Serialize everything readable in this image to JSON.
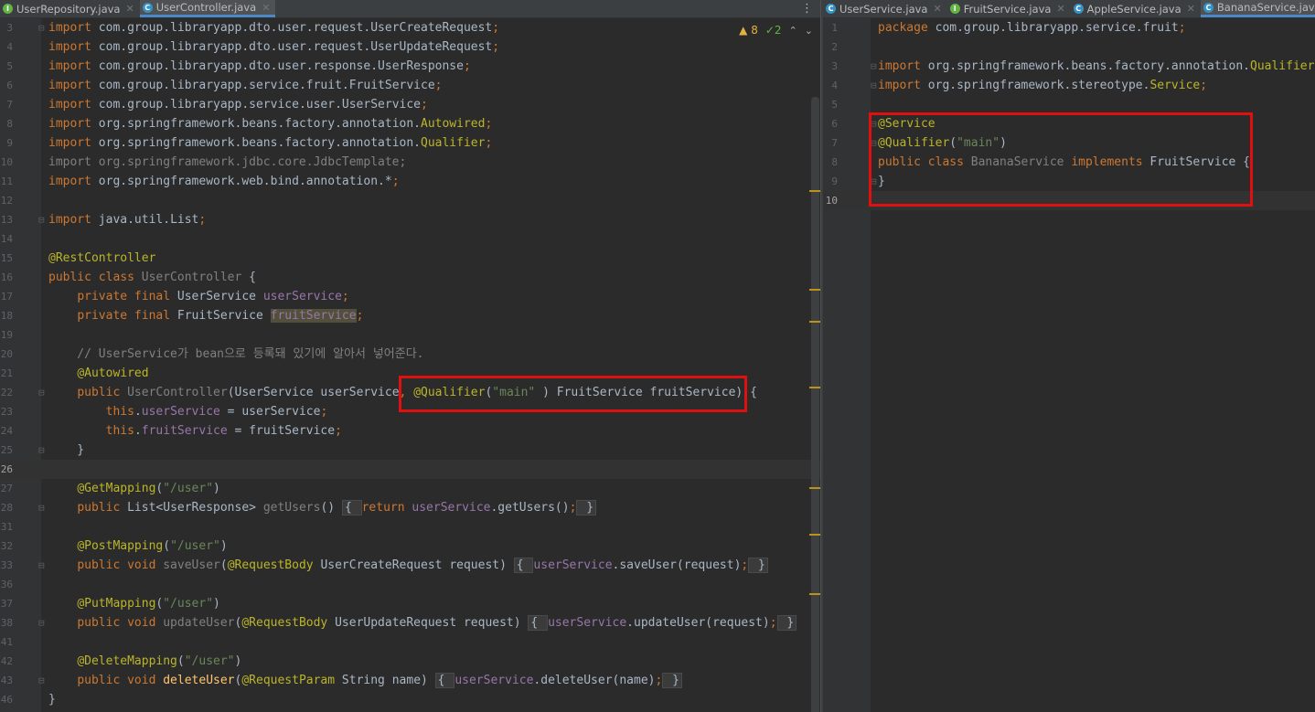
{
  "left_tabs": [
    {
      "label": "UserRepository.java",
      "icon": "interface-file-icon",
      "active": false
    },
    {
      "label": "UserController.java",
      "icon": "class-file-icon",
      "active": true
    }
  ],
  "right_tabs": [
    {
      "label": "UserService.java",
      "icon": "class-file-icon",
      "active": false
    },
    {
      "label": "FruitService.java",
      "icon": "interface-file-icon",
      "active": false
    },
    {
      "label": "AppleService.java",
      "icon": "class-file-icon",
      "active": false
    },
    {
      "label": "BananaService.java",
      "icon": "class-file-icon",
      "active": true
    }
  ],
  "tab_menu_glyph": "⋮",
  "inspections": {
    "warnings": "8",
    "ok": "2",
    "warn_glyph": "▲",
    "ok_glyph": "✓",
    "up_glyph": "⌃",
    "down_glyph": "⌄"
  },
  "left_code": [
    {
      "n": "3",
      "tokens": [
        [
          "k",
          "import "
        ],
        [
          "",
          "com.group.libraryapp.dto.user.request.UserCreateRequest"
        ],
        [
          "k",
          ";"
        ]
      ]
    },
    {
      "n": "4",
      "tokens": [
        [
          "k",
          "import "
        ],
        [
          "",
          "com.group.libraryapp.dto.user.request.UserUpdateRequest"
        ],
        [
          "k",
          ";"
        ]
      ]
    },
    {
      "n": "5",
      "tokens": [
        [
          "k",
          "import "
        ],
        [
          "",
          "com.group.libraryapp.dto.user.response.UserResponse"
        ],
        [
          "k",
          ";"
        ]
      ]
    },
    {
      "n": "6",
      "tokens": [
        [
          "k",
          "import "
        ],
        [
          "",
          "com.group.libraryapp.service.fruit.FruitService"
        ],
        [
          "k",
          ";"
        ]
      ]
    },
    {
      "n": "7",
      "tokens": [
        [
          "k",
          "import "
        ],
        [
          "",
          "com.group.libraryapp.service.user.UserService"
        ],
        [
          "k",
          ";"
        ]
      ]
    },
    {
      "n": "8",
      "tokens": [
        [
          "k",
          "import "
        ],
        [
          "",
          "org.springframework.beans.factory.annotation."
        ],
        [
          "a",
          "Autowired"
        ],
        [
          "k",
          ";"
        ]
      ]
    },
    {
      "n": "9",
      "tokens": [
        [
          "k",
          "import "
        ],
        [
          "",
          "org.springframework.beans.factory.annotation."
        ],
        [
          "a",
          "Qualifier"
        ],
        [
          "k",
          ";"
        ]
      ]
    },
    {
      "n": "10",
      "tokens": [
        [
          "dim",
          "import org.springframework.jdbc.core.JdbcTemplate;"
        ]
      ]
    },
    {
      "n": "11",
      "tokens": [
        [
          "k",
          "import "
        ],
        [
          "",
          "org.springframework.web.bind.annotation.*"
        ],
        [
          "k",
          ";"
        ]
      ]
    },
    {
      "n": "12",
      "tokens": []
    },
    {
      "n": "13",
      "tokens": [
        [
          "k",
          "import "
        ],
        [
          "",
          "java.util.List"
        ],
        [
          "k",
          ";"
        ]
      ]
    },
    {
      "n": "14",
      "tokens": []
    },
    {
      "n": "15",
      "tokens": [
        [
          "a",
          "@RestController"
        ]
      ]
    },
    {
      "n": "16",
      "tokens": [
        [
          "k",
          "public class "
        ],
        [
          "dim",
          "UserController "
        ],
        [
          "",
          "{"
        ]
      ]
    },
    {
      "n": "17",
      "tokens": [
        [
          "",
          "    "
        ],
        [
          "k",
          "private final "
        ],
        [
          "",
          "UserService "
        ],
        [
          "f",
          "userService"
        ],
        [
          "k",
          ";"
        ]
      ]
    },
    {
      "n": "18",
      "tokens": [
        [
          "",
          "    "
        ],
        [
          "k",
          "private final "
        ],
        [
          "",
          "FruitService "
        ],
        [
          "fhl",
          "fruitService"
        ],
        [
          "k",
          ";"
        ]
      ]
    },
    {
      "n": "19",
      "tokens": []
    },
    {
      "n": "20",
      "tokens": [
        [
          "cm",
          "    // UserService가 bean으로 등록돼 있기에 알아서 넣어준다."
        ]
      ]
    },
    {
      "n": "21",
      "tokens": [
        [
          "",
          "    "
        ],
        [
          "a",
          "@Autowired"
        ]
      ]
    },
    {
      "n": "22",
      "tokens": [
        [
          "",
          "    "
        ],
        [
          "k",
          "public "
        ],
        [
          "dim",
          "UserController"
        ],
        [
          "",
          "(UserService userService"
        ],
        [
          "k",
          ", "
        ],
        [
          "a",
          "@Qualifier"
        ],
        [
          "",
          "("
        ],
        [
          "s",
          "\"main\""
        ],
        [
          "",
          " ) FruitService fruitService) {"
        ]
      ]
    },
    {
      "n": "23",
      "tokens": [
        [
          "",
          "        "
        ],
        [
          "k",
          "this"
        ],
        [
          "",
          "."
        ],
        [
          "f",
          "userService"
        ],
        [
          "",
          " = userService"
        ],
        [
          "k",
          ";"
        ]
      ]
    },
    {
      "n": "24",
      "tokens": [
        [
          "",
          "        "
        ],
        [
          "k",
          "this"
        ],
        [
          "",
          "."
        ],
        [
          "f",
          "fruitService"
        ],
        [
          "",
          " = fruitService"
        ],
        [
          "k",
          ";"
        ]
      ]
    },
    {
      "n": "25",
      "tokens": [
        [
          "",
          "    }"
        ]
      ]
    },
    {
      "n": "26",
      "tokens": [],
      "caret": true
    },
    {
      "n": "27",
      "tokens": [
        [
          "",
          "    "
        ],
        [
          "a",
          "@GetMapping"
        ],
        [
          "",
          "("
        ],
        [
          "s",
          "\"/user\""
        ],
        [
          "",
          ")"
        ]
      ]
    },
    {
      "n": "28",
      "tokens": [
        [
          "",
          "    "
        ],
        [
          "k",
          "public "
        ],
        [
          "",
          "List<UserResponse> "
        ],
        [
          "dim",
          "getUsers"
        ],
        [
          "",
          "() "
        ],
        [
          "box",
          "{ "
        ],
        [
          "k",
          "return "
        ],
        [
          "f",
          "userService"
        ],
        [
          "",
          ".getUsers()"
        ],
        [
          "k",
          ";"
        ],
        [
          "box",
          " }"
        ]
      ]
    },
    {
      "n": "31",
      "tokens": []
    },
    {
      "n": "32",
      "tokens": [
        [
          "",
          "    "
        ],
        [
          "a",
          "@PostMapping"
        ],
        [
          "",
          "("
        ],
        [
          "s",
          "\"/user\""
        ],
        [
          "",
          ")"
        ]
      ]
    },
    {
      "n": "33",
      "tokens": [
        [
          "",
          "    "
        ],
        [
          "k",
          "public void "
        ],
        [
          "dim",
          "saveUser"
        ],
        [
          "",
          "("
        ],
        [
          "a",
          "@RequestBody "
        ],
        [
          "",
          "UserCreateRequest request) "
        ],
        [
          "box",
          "{ "
        ],
        [
          "f",
          "userService"
        ],
        [
          "",
          ".saveUser(request)"
        ],
        [
          "k",
          ";"
        ],
        [
          "box",
          " }"
        ]
      ]
    },
    {
      "n": "36",
      "tokens": []
    },
    {
      "n": "37",
      "tokens": [
        [
          "",
          "    "
        ],
        [
          "a",
          "@PutMapping"
        ],
        [
          "",
          "("
        ],
        [
          "s",
          "\"/user\""
        ],
        [
          "",
          ")"
        ]
      ]
    },
    {
      "n": "38",
      "tokens": [
        [
          "",
          "    "
        ],
        [
          "k",
          "public void "
        ],
        [
          "dim",
          "updateUser"
        ],
        [
          "",
          "("
        ],
        [
          "a",
          "@RequestBody "
        ],
        [
          "",
          "UserUpdateRequest request) "
        ],
        [
          "box",
          "{ "
        ],
        [
          "f",
          "userService"
        ],
        [
          "",
          ".updateUser(request)"
        ],
        [
          "k",
          ";"
        ],
        [
          "box",
          " }"
        ]
      ]
    },
    {
      "n": "41",
      "tokens": []
    },
    {
      "n": "42",
      "tokens": [
        [
          "",
          "    "
        ],
        [
          "a",
          "@DeleteMapping"
        ],
        [
          "",
          "("
        ],
        [
          "s",
          "\"/user\""
        ],
        [
          "",
          ")"
        ]
      ]
    },
    {
      "n": "43",
      "tokens": [
        [
          "",
          "    "
        ],
        [
          "k",
          "public void "
        ],
        [
          "mdecl",
          "deleteUser"
        ],
        [
          "",
          "("
        ],
        [
          "a",
          "@RequestParam "
        ],
        [
          "",
          "String name) "
        ],
        [
          "box",
          "{ "
        ],
        [
          "f",
          "userService"
        ],
        [
          "",
          ".deleteUser(name)"
        ],
        [
          "k",
          ";"
        ],
        [
          "box",
          " }"
        ]
      ]
    },
    {
      "n": "46",
      "tokens": [
        [
          "",
          "}"
        ]
      ]
    }
  ],
  "right_code": [
    {
      "n": "1",
      "tokens": [
        [
          "k",
          "package "
        ],
        [
          "",
          "com.group.libraryapp.service.fruit"
        ],
        [
          "k",
          ";"
        ]
      ]
    },
    {
      "n": "2",
      "tokens": []
    },
    {
      "n": "3",
      "tokens": [
        [
          "k",
          "import "
        ],
        [
          "",
          "org.springframework.beans.factory.annotation."
        ],
        [
          "a",
          "Qualifier"
        ],
        [
          "k",
          ";"
        ]
      ]
    },
    {
      "n": "4",
      "tokens": [
        [
          "k",
          "import "
        ],
        [
          "",
          "org.springframework.stereotype."
        ],
        [
          "a",
          "Service"
        ],
        [
          "k",
          ";"
        ]
      ]
    },
    {
      "n": "5",
      "tokens": []
    },
    {
      "n": "6",
      "tokens": [
        [
          "a",
          "@Service"
        ]
      ]
    },
    {
      "n": "7",
      "tokens": [
        [
          "a",
          "@Qualifier"
        ],
        [
          "",
          "("
        ],
        [
          "s",
          "\"main\""
        ],
        [
          "",
          ")"
        ]
      ]
    },
    {
      "n": "8",
      "tokens": [
        [
          "k",
          "public class "
        ],
        [
          "dim",
          "BananaService "
        ],
        [
          "k",
          "implements "
        ],
        [
          "",
          "FruitService {"
        ]
      ]
    },
    {
      "n": "9",
      "tokens": [
        [
          "",
          "}"
        ]
      ]
    },
    {
      "n": "10",
      "tokens": [],
      "caret": true
    }
  ]
}
